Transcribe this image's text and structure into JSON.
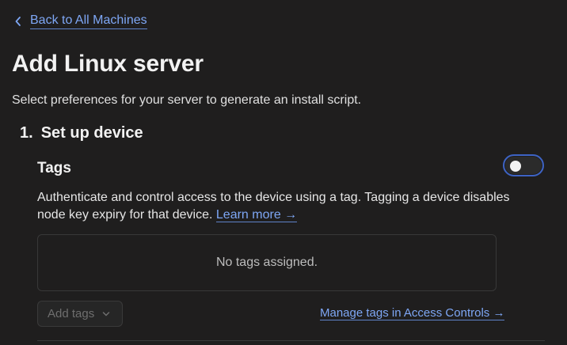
{
  "nav": {
    "back_label": "Back to All Machines"
  },
  "header": {
    "title": "Add Linux server",
    "subtitle": "Select preferences for your server to generate an install script."
  },
  "step": {
    "number": "1.",
    "title": "Set up device"
  },
  "tags": {
    "heading": "Tags",
    "toggle_on": false,
    "description": "Authenticate and control access to the device using a tag. Tagging a device disables node key expiry for that device.",
    "learn_more": "Learn more →",
    "empty_message": "No tags assigned.",
    "add_tags_label": "Add tags",
    "manage_link": "Manage tags in Access Controls →"
  },
  "colors": {
    "background": "#1f1e1e",
    "link": "#7ea7f5",
    "toggle_border": "#3d63c4"
  }
}
